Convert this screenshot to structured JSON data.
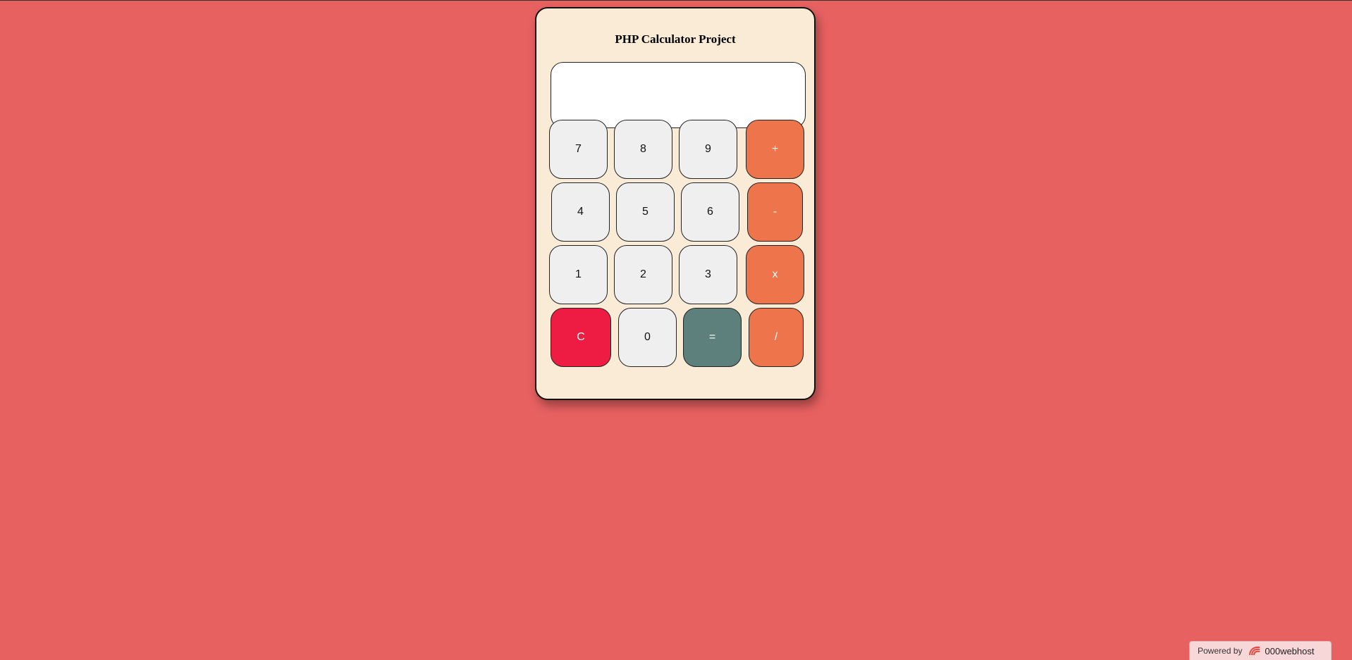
{
  "calculator": {
    "title": "PHP Calculator Project",
    "display": {
      "value": "",
      "placeholder": ""
    },
    "keys": [
      {
        "label": "7",
        "kind": "num"
      },
      {
        "label": "8",
        "kind": "num"
      },
      {
        "label": "9",
        "kind": "num"
      },
      {
        "label": "+",
        "kind": "op"
      },
      {
        "label": "4",
        "kind": "num"
      },
      {
        "label": "5",
        "kind": "num"
      },
      {
        "label": "6",
        "kind": "num"
      },
      {
        "label": "-",
        "kind": "op"
      },
      {
        "label": "1",
        "kind": "num"
      },
      {
        "label": "2",
        "kind": "num"
      },
      {
        "label": "3",
        "kind": "num"
      },
      {
        "label": "x",
        "kind": "op"
      },
      {
        "label": "C",
        "kind": "clear"
      },
      {
        "label": "0",
        "kind": "num"
      },
      {
        "label": "=",
        "kind": "equals"
      },
      {
        "label": "/",
        "kind": "op"
      }
    ]
  },
  "badge": {
    "powered_label": "Powered by",
    "brand": "000webhost",
    "icon": "000webhost-logo-icon"
  },
  "colors": {
    "page_background": "#e86161",
    "calculator_background": "#faebd7",
    "number_key": "#efefef",
    "operator_key": "#ee744b",
    "clear_key": "#ee1b42",
    "equals_key": "#5e807d"
  }
}
